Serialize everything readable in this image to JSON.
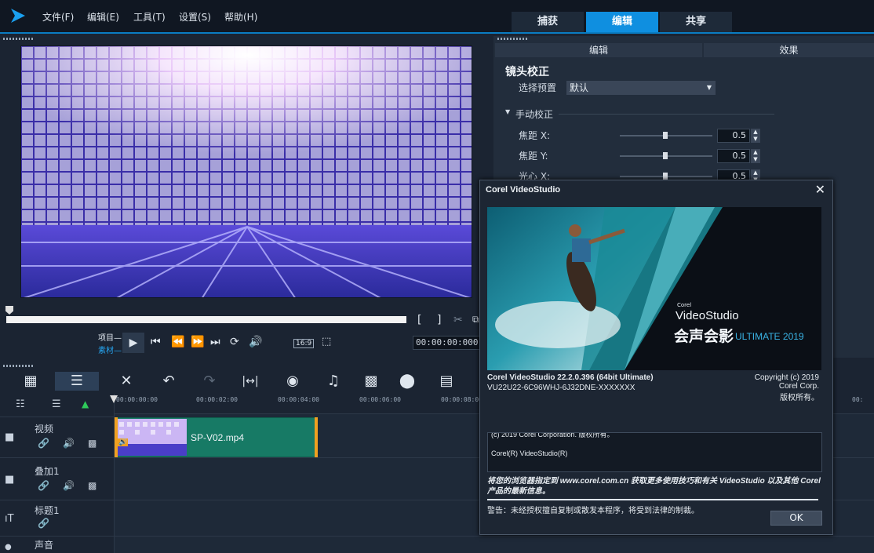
{
  "menu": {
    "file": "文件(F)",
    "edit": "编辑(E)",
    "tools": "工具(T)",
    "settings": "设置(S)",
    "help": "帮助(H)"
  },
  "modes": {
    "capture": "捕获",
    "edit": "编辑",
    "share": "共享"
  },
  "player": {
    "project_label": "项目—",
    "clip_label": "素材—",
    "aspect": "16:9",
    "timecode": "00:00:00:000"
  },
  "panel": {
    "tabs": {
      "edit": "编辑",
      "effect": "效果"
    },
    "heading": "镜头校正",
    "preset_label": "选择预置",
    "preset_value": "默认",
    "manual_label": "手动校正",
    "rows": [
      {
        "label": "焦距 X:",
        "value": "0.5"
      },
      {
        "label": "焦距 Y:",
        "value": "0.5"
      },
      {
        "label": "光心 X:",
        "value": "0.5"
      }
    ]
  },
  "ruler": {
    "t0": "00:00:00:00",
    "t1": "00:00:02:00",
    "t2": "00:00:04:00",
    "t3": "00:00:06:00",
    "t4": "00:00:08:00",
    "t5": "00:"
  },
  "tracks": {
    "video": "视频",
    "overlay": "叠加1",
    "title": "标题1",
    "audio": "声音"
  },
  "clip": {
    "name": "SP-V02.mp4"
  },
  "dialog": {
    "title": "Corel VideoStudio",
    "brand_small": "Corel",
    "brand": "VideoStudio",
    "brand_cn": "会声会影",
    "edition": "ULTIMATE 2019",
    "version": "Corel VideoStudio 22.2.0.396  (64bit Ultimate)",
    "serial": "VU22U22-6C96WHJ-6J32DNE-XXXXXXX",
    "copyright1": "Copyright (c) 2019",
    "copyright2": "Corel Corp.",
    "copyright3": "版权所有。",
    "license_line1": "(c) 2019 Corel Corporation. 版权所有。",
    "license_line2": "Corel(R) VideoStudio(R)",
    "notice": "将您的浏览器指定到 www.corel.com.cn 获取更多使用技巧和有关 VideoStudio 以及其他 Corel 产品的最新信息。",
    "warning": "警告：未经授权擅自复制或散发本程序，将受到法律的制裁。",
    "ok": "OK"
  }
}
